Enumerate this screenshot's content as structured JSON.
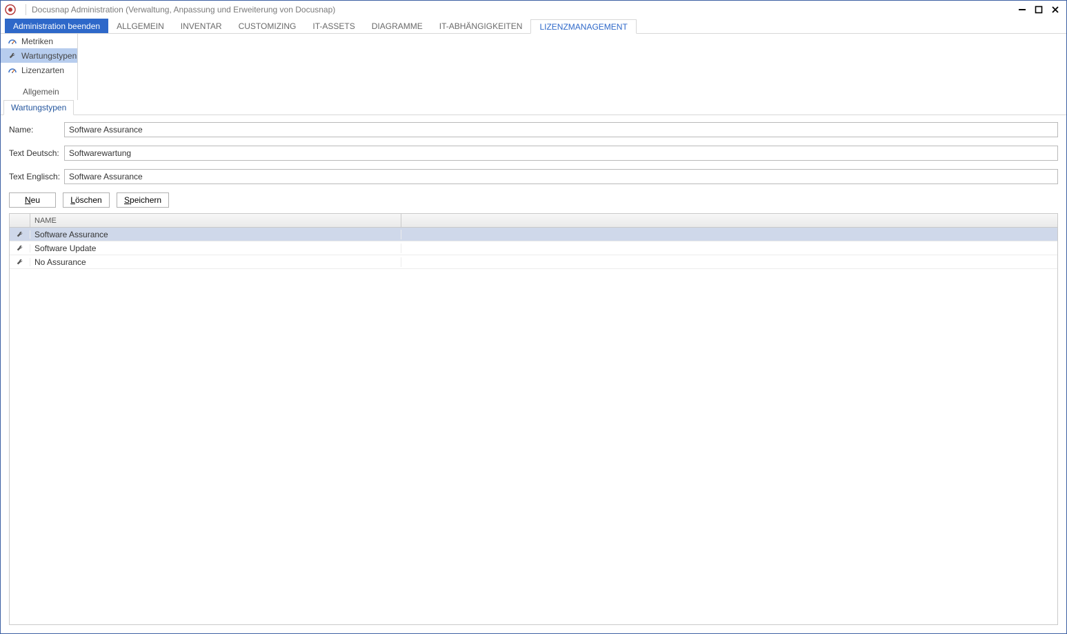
{
  "window": {
    "title": "Docusnap Administration (Verwaltung, Anpassung und Erweiterung von Docusnap)"
  },
  "ribbon": {
    "primary": "Administration beenden",
    "tabs": [
      "ALLGEMEIN",
      "INVENTAR",
      "CUSTOMIZING",
      "IT-ASSETS",
      "DIAGRAMME",
      "IT-ABHÄNGIGKEITEN",
      "LIZENZMANAGEMENT"
    ],
    "active": "LIZENZMANAGEMENT"
  },
  "sidebar": {
    "items": [
      {
        "label": "Metriken",
        "icon": "gauge"
      },
      {
        "label": "Wartungstypen",
        "icon": "wrench",
        "selected": true
      },
      {
        "label": "Lizenzarten",
        "icon": "gauge"
      }
    ],
    "group_label": "Allgemein"
  },
  "subtab": {
    "label": "Wartungstypen"
  },
  "form": {
    "labels": {
      "name": "Name:",
      "text_de": "Text Deutsch:",
      "text_en": "Text Englisch:"
    },
    "values": {
      "name": "Software Assurance",
      "text_de": "Softwarewartung",
      "text_en": "Software Assurance"
    },
    "buttons": {
      "new": "Neu",
      "delete": "Löschen",
      "save": "Speichern",
      "new_ul": "N",
      "delete_ul": "L",
      "save_ul": "S",
      "new_rest": "eu",
      "delete_rest": "öschen",
      "save_rest": "peichern"
    }
  },
  "grid": {
    "columns": {
      "name": "NAME"
    },
    "rows": [
      {
        "name": "Software Assurance",
        "selected": true
      },
      {
        "name": "Software Update"
      },
      {
        "name": "No Assurance"
      }
    ]
  }
}
